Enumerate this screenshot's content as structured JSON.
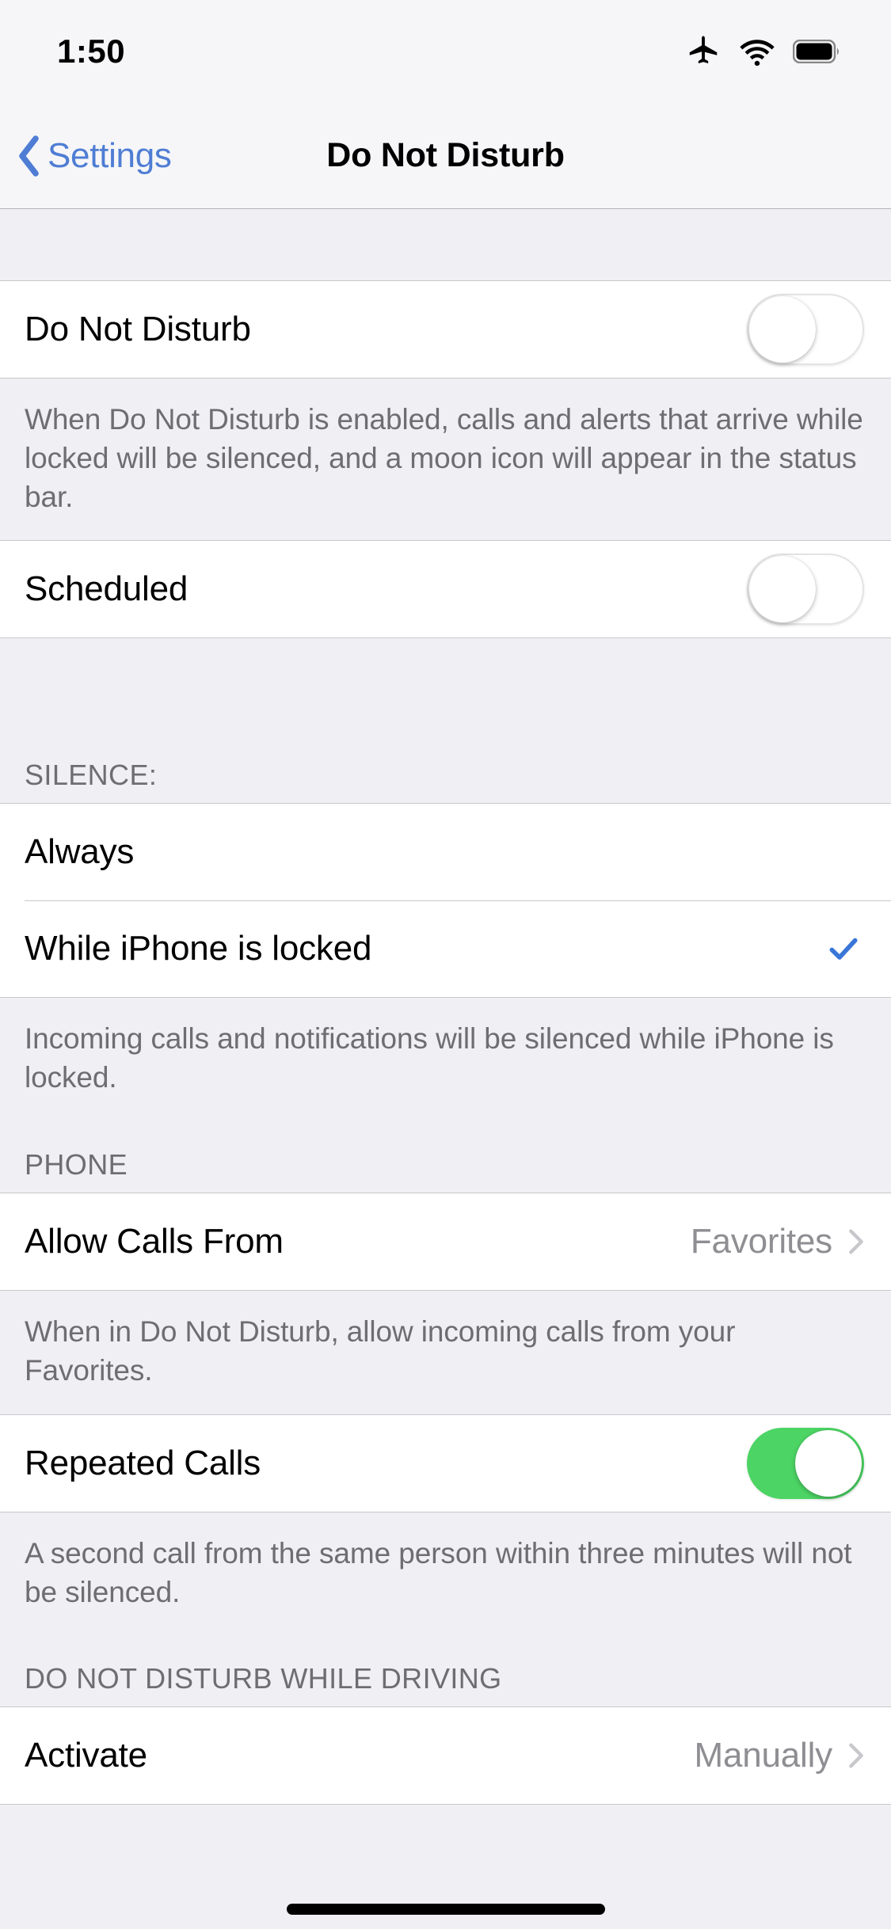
{
  "status_bar": {
    "time": "1:50",
    "icons": [
      "airplane-mode-icon",
      "wifi-icon",
      "battery-icon"
    ]
  },
  "nav_bar": {
    "back_label": "Settings",
    "back_icon": "chevron-left-icon",
    "title": "Do Not Disturb"
  },
  "colors": {
    "accent_blue": "#4F7DD4",
    "toggle_on_green": "#4CD464",
    "group_background": "#FFFFFF",
    "page_background": "#EFEFF4",
    "secondary_text": "#6D6D72",
    "value_text": "#8E8E93"
  },
  "sections": {
    "dnd": {
      "row_label": "Do Not Disturb",
      "toggle_state": "off",
      "footer": "When Do Not Disturb is enabled, calls and alerts that arrive while locked will be silenced, and a moon icon will appear in the status bar."
    },
    "scheduled": {
      "row_label": "Scheduled",
      "toggle_state": "off"
    },
    "silence": {
      "header": "SILENCE:",
      "options": [
        {
          "label": "Always",
          "selected": false
        },
        {
          "label": "While iPhone is locked",
          "selected": true
        }
      ],
      "footer": "Incoming calls and notifications will be silenced while iPhone is locked."
    },
    "phone": {
      "header": "PHONE",
      "allow_calls": {
        "label": "Allow Calls From",
        "value": "Favorites",
        "accessory": "chevron-right-icon"
      },
      "footer": "When in Do Not Disturb, allow incoming calls from your Favorites.",
      "repeated_calls": {
        "label": "Repeated Calls",
        "toggle_state": "on"
      },
      "repeated_footer": "A second call from the same person within three minutes will not be silenced."
    },
    "driving": {
      "header": "DO NOT DISTURB WHILE DRIVING",
      "activate": {
        "label": "Activate",
        "value": "Manually",
        "accessory": "chevron-right-icon"
      }
    }
  }
}
